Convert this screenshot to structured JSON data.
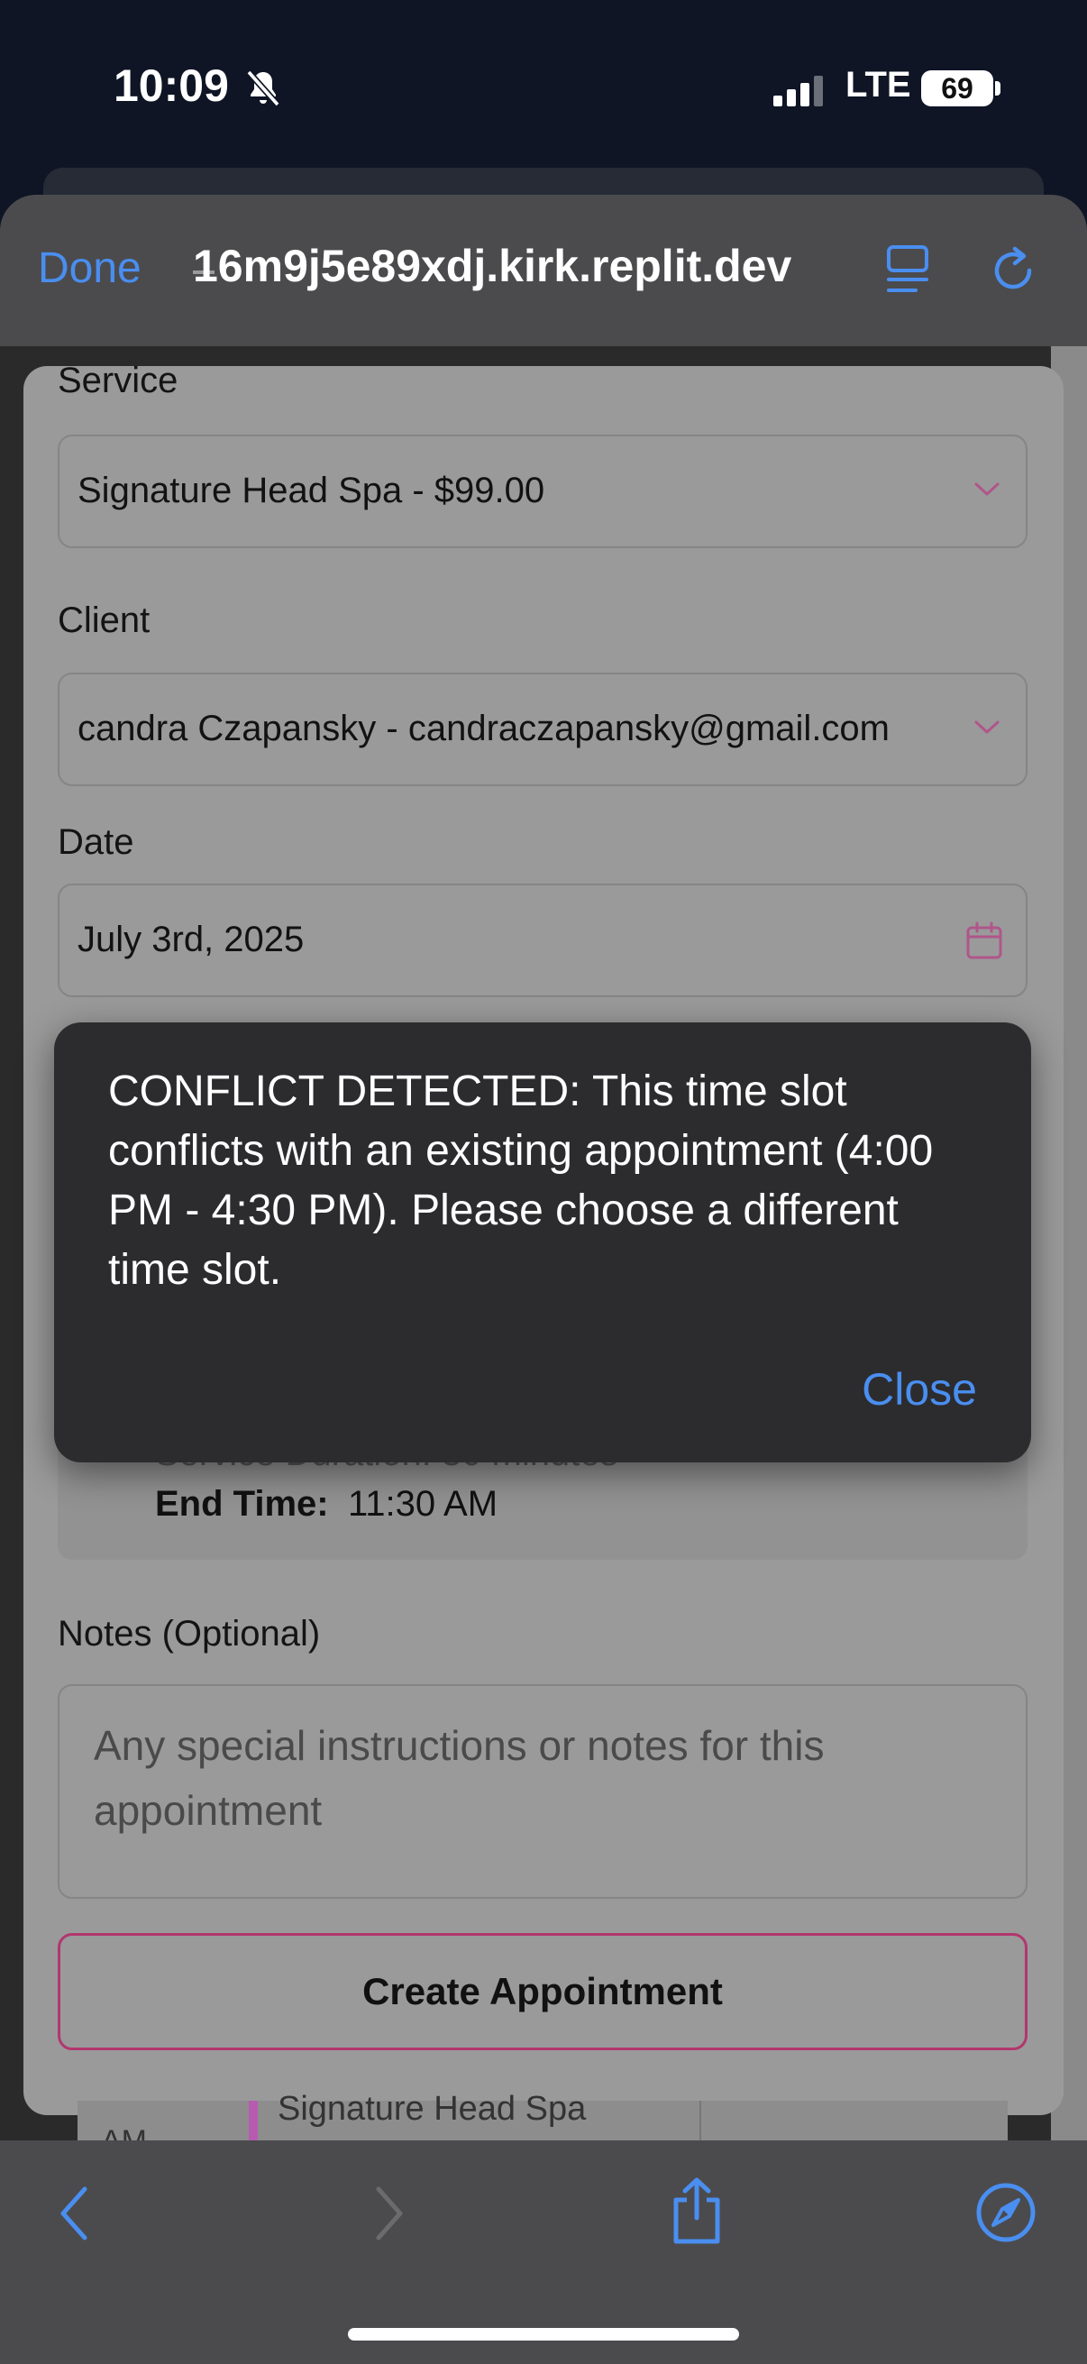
{
  "status_bar": {
    "time": "10:09",
    "network": "LTE",
    "battery": "69"
  },
  "browser": {
    "done_label": "Done",
    "url": "16m9j5e89xdj.kirk.replit.dev"
  },
  "form": {
    "service": {
      "label": "Service",
      "value": "Signature Head Spa - $99.00"
    },
    "client": {
      "label": "Client",
      "value": "candra Czapansky - candraczapansky@gmail.com"
    },
    "date": {
      "label": "Date",
      "value": "July 3rd, 2025"
    },
    "summary": {
      "partial_line": "Service Duration: 30 minutes",
      "end_time_label": "End Time:",
      "end_time_value": "11:30 AM"
    },
    "notes": {
      "label": "Notes (Optional)",
      "placeholder": "Any special instructions or notes for this appointment"
    },
    "create_button": "Create Appointment"
  },
  "background_calendar": {
    "time": "AM",
    "event": "Signature Head Spa"
  },
  "alert": {
    "message": "CONFLICT DETECTED: This time slot conflicts with an existing appointment (4:00 PM - 4:30 PM). Please choose a different time slot.",
    "close_label": "Close"
  },
  "toolbar_icons": [
    "back-icon",
    "forward-icon",
    "share-icon",
    "compass-icon"
  ],
  "colors": {
    "accent_blue": "#4a8ef0",
    "button_border": "#b2376e",
    "alert_bg": "#2c2c2e"
  }
}
